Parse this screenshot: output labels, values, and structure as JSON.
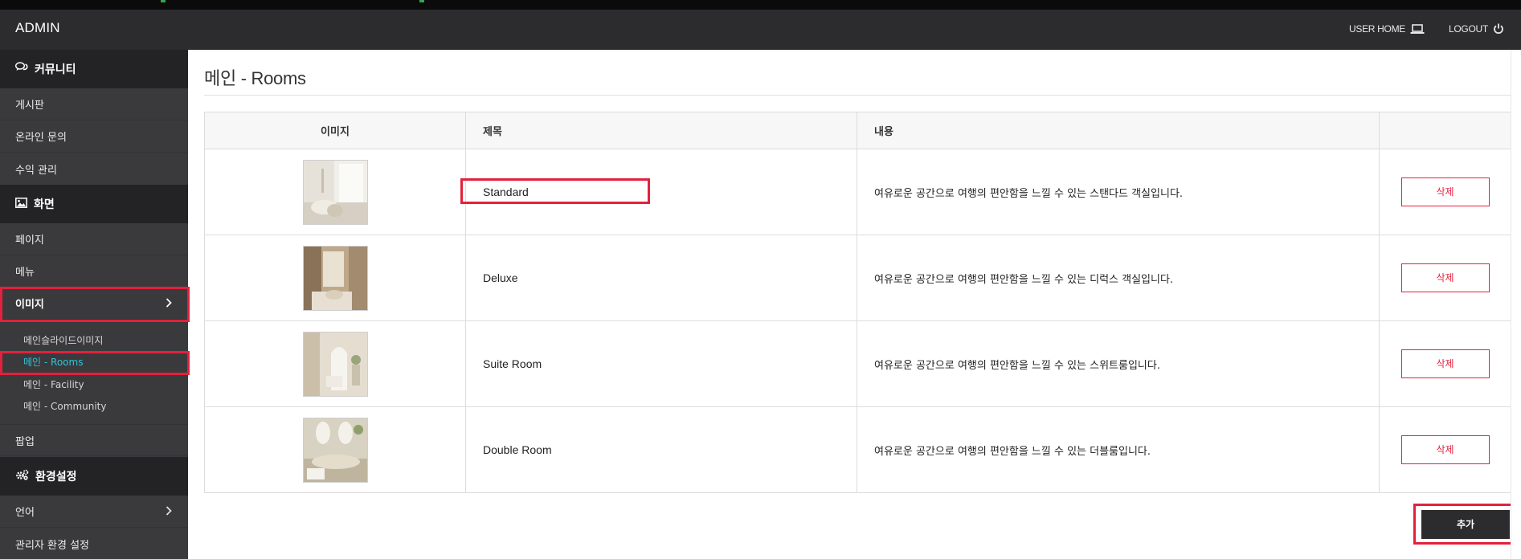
{
  "header": {
    "brand": "ADMIN",
    "user_home": "USER HOME",
    "logout": "LOGOUT"
  },
  "sidebar": {
    "sections": [
      {
        "label": "커뮤니티",
        "icon": "chat-icon"
      },
      {
        "label": "화면",
        "icon": "image-icon"
      },
      {
        "label": "환경설정",
        "icon": "gears-icon"
      }
    ],
    "community_items": [
      "게시판",
      "온라인 문의",
      "수익 관리"
    ],
    "screen_items": [
      "페이지",
      "메뉴",
      "이미지"
    ],
    "image_sub_items": [
      "메인슬라이드이미지",
      "메인 - Rooms",
      "메인 - Facility",
      "메인 - Community"
    ],
    "popup": "팝업",
    "settings_items": [
      "언어",
      "관리자 환경 설정"
    ]
  },
  "main": {
    "title": "메인 - Rooms",
    "columns": [
      "이미지",
      "제목",
      "내용",
      ""
    ],
    "rows": [
      {
        "title": "Standard",
        "content": "여유로운 공간으로 여행의 편안함을 느낄 수 있는 스탠다드 객실입니다.",
        "delete": "삭제"
      },
      {
        "title": "Deluxe",
        "content": "여유로운 공간으로 여행의 편안함을 느낄 수 있는 디럭스 객실입니다.",
        "delete": "삭제"
      },
      {
        "title": "Suite Room",
        "content": "여유로운 공간으로 여행의 편안함을 느낄 수 있는 스위트룸입니다.",
        "delete": "삭제"
      },
      {
        "title": "Double Room",
        "content": "여유로운 공간으로 여행의 편안함을 느낄 수 있는 더블룸입니다.",
        "delete": "삭제"
      }
    ],
    "add_button": "추가"
  },
  "colors": {
    "header_bg": "#2c2c2f",
    "sidebar_bg": "#3a3a3d",
    "section_bg": "#232325",
    "accent_active": "#2ec4d8",
    "danger": "#e3213c",
    "highlight": "#e3213c"
  }
}
